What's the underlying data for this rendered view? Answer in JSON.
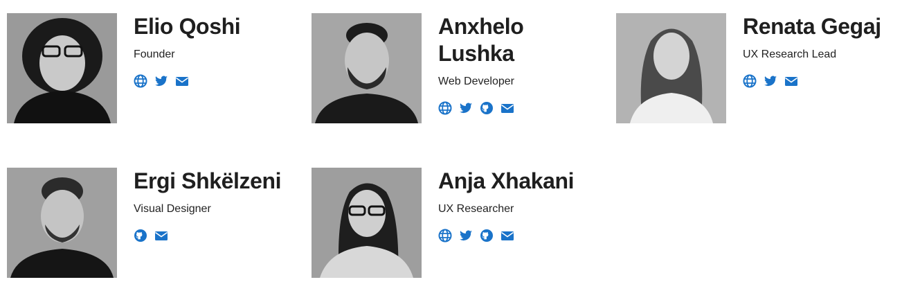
{
  "team": [
    {
      "name": "Elio Qoshi",
      "role": "Founder",
      "photo_alt": "Elio Qoshi",
      "links": [
        "globe-icon",
        "twitter-icon",
        "envelope-icon"
      ]
    },
    {
      "name": "Anxhelo Lushka",
      "role": "Web Developer",
      "photo_alt": "Anxhelo Lushka",
      "links": [
        "globe-icon",
        "twitter-icon",
        "github-icon",
        "envelope-icon"
      ]
    },
    {
      "name": "Renata Gegaj",
      "role": "UX Research Lead",
      "photo_alt": "Renata Gegaj",
      "links": [
        "globe-icon",
        "twitter-icon",
        "envelope-icon"
      ]
    },
    {
      "name": "Ergi Shkëlzeni",
      "role": "Visual Designer",
      "photo_alt": "Ergi Shkëlzeni",
      "links": [
        "github-icon",
        "envelope-icon"
      ]
    },
    {
      "name": "Anja Xhakani",
      "role": "UX Researcher",
      "photo_alt": "Anja Xhakani",
      "links": [
        "globe-icon",
        "twitter-icon",
        "github-icon",
        "envelope-icon"
      ]
    }
  ],
  "colors": {
    "link": "#1a73c9",
    "text": "#1f1f1f"
  }
}
